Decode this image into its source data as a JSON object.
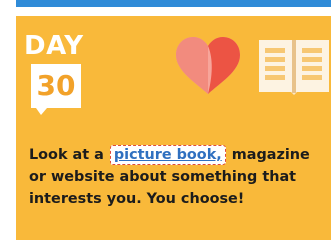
{
  "colors": {
    "top_bar": "#2f8bd8",
    "card_background": "#f9b93a",
    "day_text": "#ffffff",
    "day_number": "#f2a22a",
    "heart": "#ef5a4a",
    "link": "#2f70c0",
    "link_border": "#e04b3a"
  },
  "day": {
    "label": "DAY",
    "number": "30"
  },
  "icons": {
    "heart": "heart-icon",
    "book": "open-book-icon"
  },
  "prompt": {
    "before_link": "Look at a",
    "link_text": "picture book,",
    "after_link": " magazine or website about something that interests you. You choose!"
  }
}
